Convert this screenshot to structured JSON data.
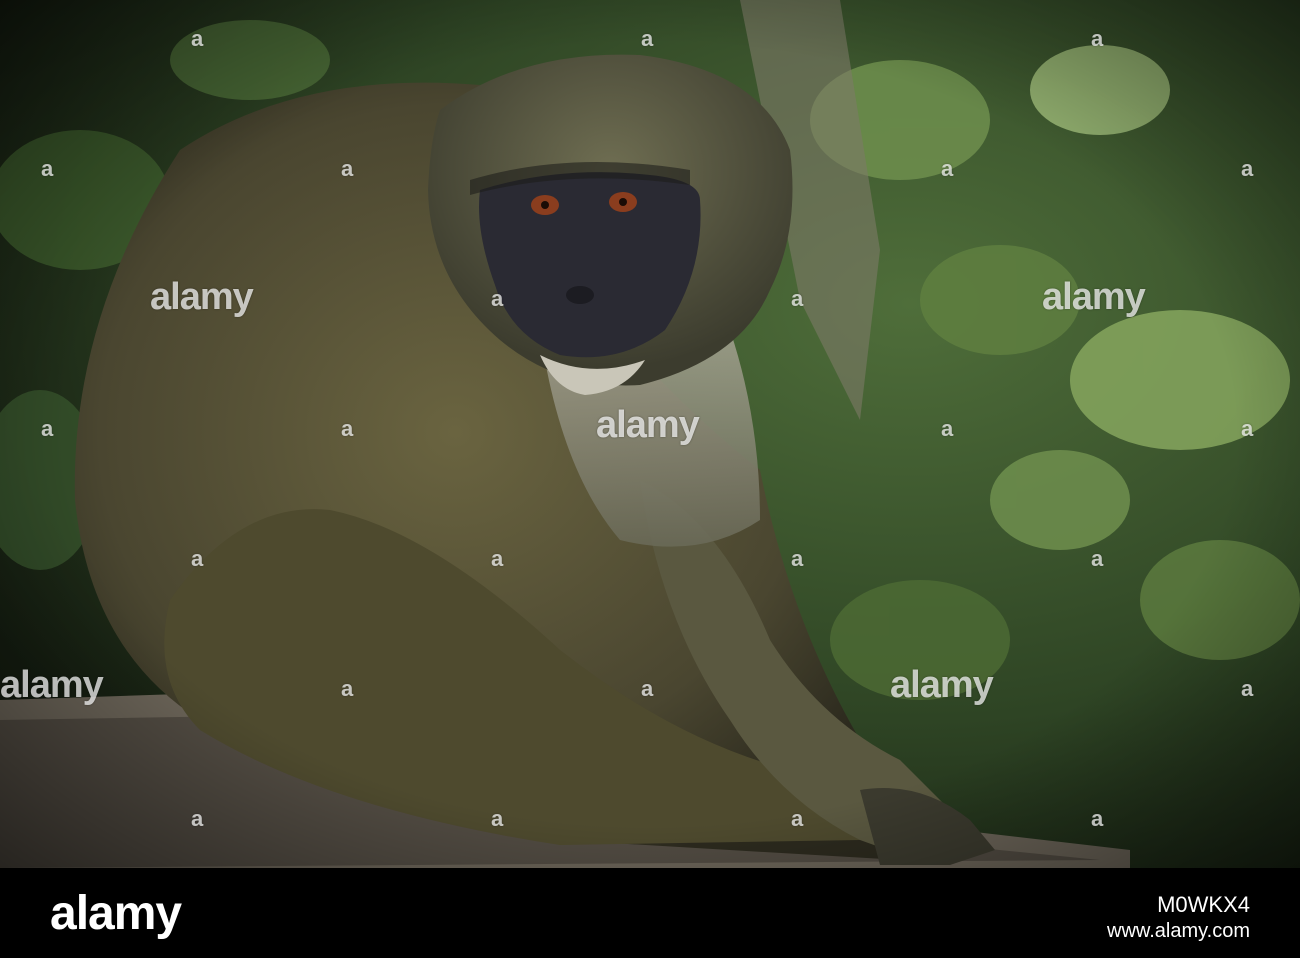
{
  "image": {
    "subject": "monkey-on-branch",
    "colors": {
      "foliage_dark": "#1f2a1a",
      "foliage_mid": "#3e5a2e",
      "foliage_light": "#8fae6a",
      "fur_olive": "#4f4a2f",
      "fur_gray": "#6d6d5e",
      "face_dark": "#2a2a33",
      "branch": "#6b6458"
    }
  },
  "watermark": {
    "text": "alamy",
    "mark": "a"
  },
  "footer": {
    "logo": "alamy",
    "image_id": "M0WKX4",
    "url": "www.alamy.com"
  }
}
